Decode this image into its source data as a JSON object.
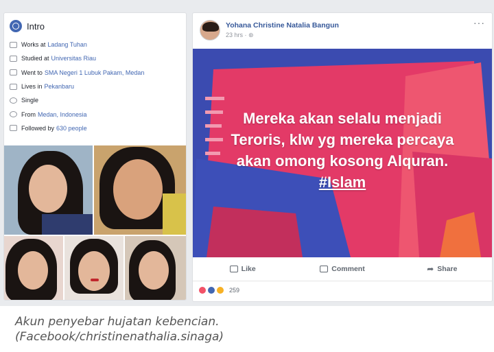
{
  "intro": {
    "title": "Intro",
    "items": [
      {
        "prefix": "Works at",
        "link": "Ladang Tuhan",
        "icon": "briefcase-icon"
      },
      {
        "prefix": "Studied at",
        "link": "Universitas Riau",
        "icon": "graduation-cap-icon"
      },
      {
        "prefix": "Went to",
        "link": "SMA Negeri 1 Lubuk Pakam, Medan",
        "icon": "graduation-cap-icon"
      },
      {
        "prefix": "Lives in",
        "link": "Pekanbaru",
        "icon": "home-icon"
      },
      {
        "prefix": "Single",
        "link": "",
        "icon": "heart-icon"
      },
      {
        "prefix": "From",
        "link": "Medan, Indonesia",
        "icon": "location-pin-icon"
      },
      {
        "prefix": "Followed by",
        "link": "630 people",
        "icon": "followers-icon"
      }
    ]
  },
  "post": {
    "author": "Yohana Christine Natalia Bangun",
    "time": "23 hrs · ",
    "more": "···",
    "text_lines": [
      "Mereka akan selalu menjadi",
      "Teroris, klw yg mereka percaya",
      "akan omong kosong Alquran."
    ],
    "hashtag": "#Islam",
    "actions": {
      "like": "Like",
      "comment": "Comment",
      "share": "Share"
    },
    "reaction_count": "259",
    "colors": {
      "banner_bg": "#3b4bb0",
      "panel_pink": "#e33a67",
      "accent_orange": "#f0703e",
      "link": "#365899"
    }
  },
  "caption": {
    "line1": "Akun penyebar hujatan kebencian.",
    "line2": "(Facebook/christinenathalia.sinaga)"
  }
}
